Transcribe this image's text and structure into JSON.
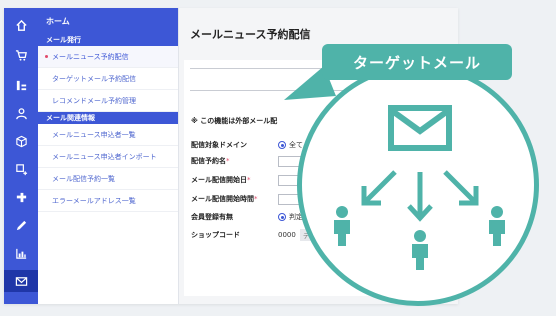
{
  "sidebar": {
    "home": "ホーム",
    "sections": [
      {
        "label": "メール発行",
        "items": [
          {
            "label": "メールニュース予約配信",
            "active": true
          },
          {
            "label": "ターゲットメール予約配信"
          },
          {
            "label": "レコメンドメール予約管理"
          }
        ]
      },
      {
        "label": "メール関連情報",
        "items": [
          {
            "label": "メールニュース申込者一覧"
          },
          {
            "label": "メールニュース申込者インポート"
          },
          {
            "label": "メール配信予約一覧"
          },
          {
            "label": "エラーメールアドレス一覧"
          }
        ]
      }
    ]
  },
  "rail_icons": [
    "home-icon",
    "cart-icon",
    "stack-icon",
    "user-icon",
    "box-icon",
    "exchange-icon",
    "puzzle-icon",
    "pen-icon",
    "chart-icon",
    "mail-icon"
  ],
  "main": {
    "title": "メールニュース予約配信",
    "notice": "※ この機能は外部メール配",
    "fields": {
      "target": {
        "label": "配信対象ドメイン",
        "value": "全て"
      },
      "name": {
        "label": "配信予約名",
        "req": "*"
      },
      "start_date": {
        "label": "メール配信開始日",
        "req": "*"
      },
      "start_time": {
        "label": "メール配信開始時間",
        "req": "*"
      },
      "member": {
        "label": "会員登録有無",
        "value": "判定"
      },
      "shop": {
        "label": "ショップコード",
        "code": "0000",
        "pill": "テスト"
      }
    }
  },
  "callout": {
    "title": "ターゲットメール",
    "accent": "#4fb3a9"
  }
}
